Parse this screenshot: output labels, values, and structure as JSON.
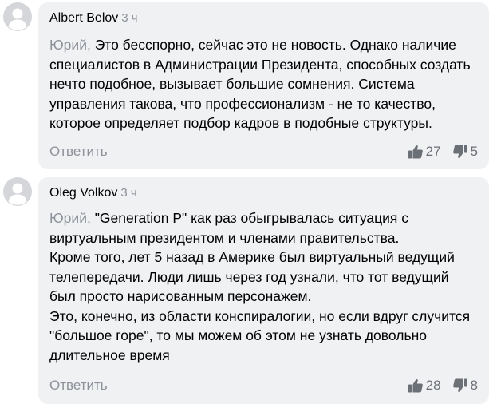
{
  "comments": [
    {
      "author": "Albert Belov",
      "time": "3 ч",
      "mention": "Юрий,",
      "lines": [
        " Это бесспорно, сейчас это не новость. Однако наличие",
        "специалистов в Администрации Президента, способных создать",
        "нечто подобное, вызывает большие сомнения. Система",
        "управления такова, что профессионализм - не то качество,",
        "которое определяет подбор кадров в подобные структуры."
      ],
      "reply_label": "Ответить",
      "likes": "27",
      "dislikes": "5"
    },
    {
      "author": "Oleg Volkov",
      "time": "3 ч",
      "mention": "Юрий,",
      "lines": [
        " \"Generation P\" как раз обыгрывалась ситуация с",
        "виртуальным президентом и членами правительства.",
        "Кроме того, лет 5 назад в Америке был виртуальный ведущий",
        "телепередачи. Люди лишь через год узнали, что тот ведущий",
        "был просто нарисованным персонажем.",
        "Это, конечно, из области конспиралогии, но если вдруг случится",
        "\"большое горе\", то мы можем об этом не узнать довольно",
        "длительное время"
      ],
      "reply_label": "Ответить",
      "likes": "28",
      "dislikes": "8"
    }
  ],
  "icons": {
    "avatar": "user-avatar-icon",
    "like": "thumbs-up-icon",
    "dislike": "thumbs-down-icon"
  },
  "colors": {
    "bubble": "#f0f1f3",
    "muted": "#8d9199",
    "icon": "#6b6f76"
  }
}
